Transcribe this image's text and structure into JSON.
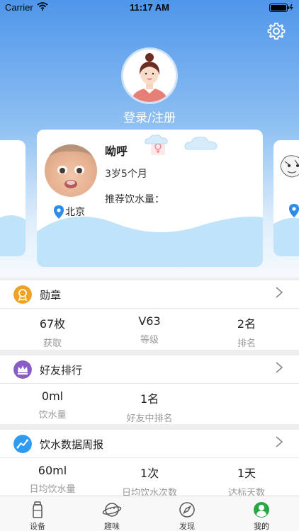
{
  "status_bar": {
    "carrier": "Carrier",
    "time": "11:17 AM"
  },
  "header": {
    "login_label": "登录/注册"
  },
  "child_card": {
    "name": "呦呼",
    "age": "3岁5个月",
    "water_label": "推荐饮水量：",
    "location": "北京"
  },
  "sections": {
    "medals": {
      "title": "勋章",
      "stats": [
        {
          "value": "67枚",
          "label": "获取"
        },
        {
          "value": "V63",
          "label": "等级"
        },
        {
          "value": "2名",
          "label": "排名"
        }
      ]
    },
    "friends": {
      "title": "好友排行",
      "stats": [
        {
          "value": "0ml",
          "label": "饮水量"
        },
        {
          "value": "1名",
          "label": "好友中排名"
        }
      ]
    },
    "weekly": {
      "title": "饮水数据周报",
      "stats": [
        {
          "value": "60ml",
          "label": "日均饮水量"
        },
        {
          "value": "1次",
          "label": "日均饮水次数"
        },
        {
          "value": "1天",
          "label": "达标天数"
        }
      ]
    }
  },
  "tabbar": {
    "items": [
      {
        "label": "设备",
        "icon": "bottle-icon"
      },
      {
        "label": "趣味",
        "icon": "planet-icon"
      },
      {
        "label": "发现",
        "icon": "compass-icon"
      },
      {
        "label": "我的",
        "icon": "profile-icon"
      }
    ],
    "active": "我的"
  },
  "colors": {
    "hero_top": "#4f96ea",
    "medal_icon": "#f0a022",
    "friends_icon": "#8a5cc8",
    "weekly_icon": "#2f9bf0",
    "active_tab": "#27a844",
    "location_pin": "#2f8be8"
  }
}
